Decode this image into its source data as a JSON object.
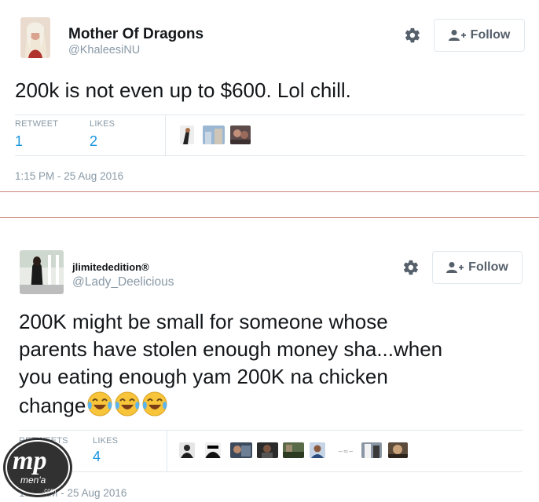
{
  "tweet1": {
    "display_name": "Mother Of Dragons",
    "handle": "@KhaleesiNU",
    "follow_label": "Follow",
    "text": "200k is not even up to $600. Lol chill.",
    "stats": [
      {
        "label": "RETWEET",
        "value": "1"
      },
      {
        "label": "LIKES",
        "value": "2"
      }
    ],
    "timestamp": "1:15 PM - 25 Aug 2016"
  },
  "tweet2": {
    "display_name": "jlimitededition®",
    "handle": "@Lady_Deelicious",
    "follow_label": "Follow",
    "text_lines": [
      "200K might be small for someone whose",
      "parents have stolen enough money sha...when",
      "you eating enough yam 200K na chicken",
      "change"
    ],
    "emojis": [
      "tears-of-joy-emoji",
      "tears-of-joy-emoji",
      "tears-of-joy-emoji"
    ],
    "stats": [
      {
        "label": "RETWEETS",
        "value": ""
      },
      {
        "label": "LIKES",
        "value": "4"
      }
    ],
    "timestamp": "1:15 AM - 25 Aug 2016"
  },
  "watermark": {
    "brand": "mp",
    "sub": "men'a",
    "domain": ".com"
  },
  "icons": {
    "gear": "gear-icon",
    "follow": "add-user-icon"
  },
  "colors": {
    "link_blue": "#1b95e0",
    "muted_gray": "#8899a6",
    "border": "#e1e8ed",
    "divider_red": "#c9847a"
  }
}
